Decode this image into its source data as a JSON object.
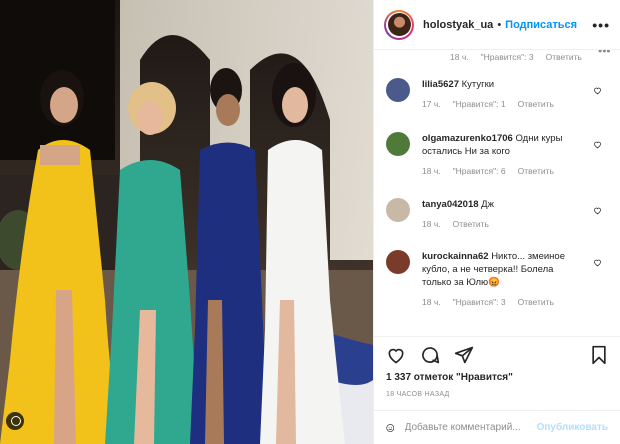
{
  "post": {
    "username": "holostyak_ua",
    "separator": "•",
    "follow_label": "Подписаться",
    "more_label": "•••"
  },
  "top_comment_meta": {
    "time": "18 ч.",
    "likes": "\"Нравится\": 3",
    "reply": "Ответить",
    "more": "•••"
  },
  "comments": [
    {
      "user": "lilia5627",
      "text": "Кутугки",
      "time": "17 ч.",
      "likes": "\"Нравится\": 1",
      "reply": "Ответить",
      "avatar_color": "#4a5a8a"
    },
    {
      "user": "olgamazurenko1706",
      "text": "Одни куры остались Ни за кого",
      "time": "18 ч.",
      "likes": "\"Нравится\": 6",
      "reply": "Ответить",
      "avatar_color": "#4f7a3a"
    },
    {
      "user": "tanya042018",
      "text": "Дж",
      "time": "18 ч.",
      "likes": "",
      "reply": "Ответить",
      "avatar_color": "#c7b9a6"
    },
    {
      "user": "kurockainna62",
      "text": "Никто... змеиное кубло, а не четверка!! Болела только за Юлю😡",
      "time": "18 ч.",
      "likes": "\"Нравится\": 3",
      "reply": "Ответить",
      "avatar_color": "#7a3b2a"
    }
  ],
  "footer": {
    "likes_count": "1 337 отметок \"Нравится\"",
    "posted_time": "18 часов назад",
    "comment_placeholder": "Добавьте комментарий...",
    "publish_label": "Опубликовать"
  },
  "colors": {
    "link_blue": "#0095f6",
    "publish_disabled": "#b2dffc",
    "meta_gray": "#8e8e8e"
  },
  "icons": [
    "heart-icon",
    "comment-icon",
    "share-icon",
    "bookmark-icon",
    "smile-icon",
    "tag-icon"
  ]
}
